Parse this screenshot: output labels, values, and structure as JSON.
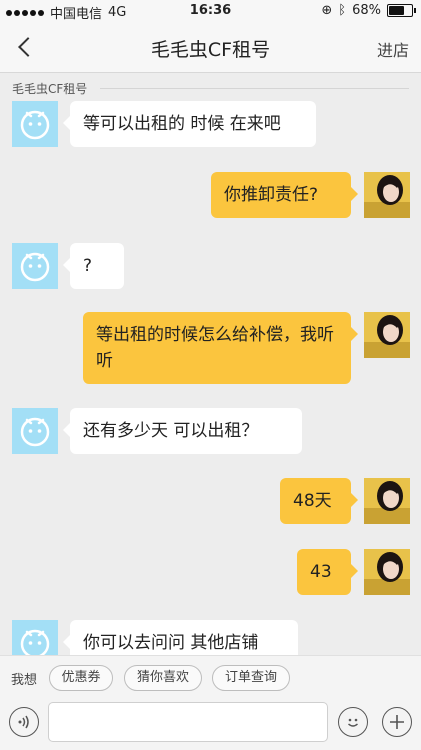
{
  "status_bar": {
    "carrier": "中国电信",
    "network": "4G",
    "time": "16:36",
    "battery": "68%",
    "battery_level": 0.68
  },
  "header": {
    "title": "毛毛虫CF租号",
    "right_action": "进店"
  },
  "chat": {
    "shop_label": "毛毛虫CF租号",
    "messages": [
      {
        "from": "shop",
        "text": "等可以出租的 时候  在来吧"
      },
      {
        "from": "me",
        "text": "你推卸责任?"
      },
      {
        "from": "shop",
        "text": "?"
      },
      {
        "from": "me",
        "text": "等出租的时候怎么给补偿，我听听"
      },
      {
        "from": "shop",
        "text": "还有多少天   可以出租？"
      },
      {
        "from": "me",
        "text": "48天"
      },
      {
        "from": "me",
        "text": "43"
      },
      {
        "from": "shop",
        "text": "你可以去问问 其他店铺"
      }
    ]
  },
  "quick_replies": {
    "lead": "我想",
    "chips": [
      "优惠券",
      "猜你喜欢",
      "订单查询"
    ]
  },
  "input_bar": {
    "placeholder": "",
    "value": ""
  },
  "colors": {
    "outgoing_bubble": "#fbc53e",
    "incoming_bubble": "#ffffff",
    "shop_avatar": "#a3dff6",
    "background": "#ededed"
  }
}
